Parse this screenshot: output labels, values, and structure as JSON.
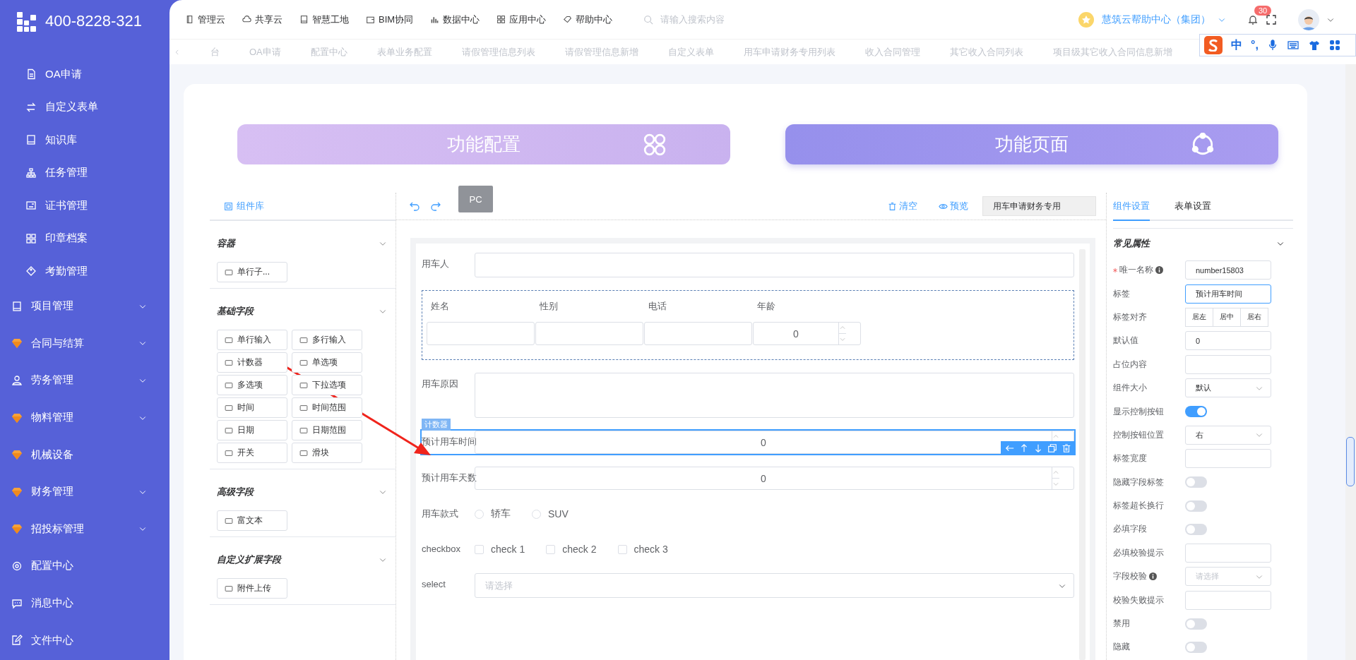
{
  "sidebar": {
    "logo_text": "400-8228-321",
    "items": [
      {
        "label": "OA申请",
        "kind": "sub",
        "expandable": false
      },
      {
        "label": "自定义表单",
        "kind": "sub",
        "expandable": false
      },
      {
        "label": "知识库",
        "kind": "sub",
        "expandable": false
      },
      {
        "label": "任务管理",
        "kind": "sub",
        "expandable": false
      },
      {
        "label": "证书管理",
        "kind": "sub",
        "expandable": false
      },
      {
        "label": "印章档案",
        "kind": "sub",
        "expandable": false
      },
      {
        "label": "考勤管理",
        "kind": "sub",
        "expandable": false
      },
      {
        "label": "项目管理",
        "kind": "group",
        "expandable": true
      },
      {
        "label": "合同与结算",
        "kind": "group",
        "expandable": true
      },
      {
        "label": "劳务管理",
        "kind": "group",
        "expandable": true
      },
      {
        "label": "物料管理",
        "kind": "group",
        "expandable": true
      },
      {
        "label": "机械设备",
        "kind": "group",
        "expandable": false
      },
      {
        "label": "财务管理",
        "kind": "group",
        "expandable": true
      },
      {
        "label": "招投标管理",
        "kind": "group",
        "expandable": true
      },
      {
        "label": "配置中心",
        "kind": "group",
        "expandable": false
      },
      {
        "label": "消息中心",
        "kind": "group",
        "expandable": false
      },
      {
        "label": "文件中心",
        "kind": "group",
        "expandable": false
      }
    ]
  },
  "topbar": {
    "nav": [
      "管理云",
      "共享云",
      "智慧工地",
      "BIM协同",
      "数据中心",
      "应用中心",
      "帮助中心"
    ],
    "search": {
      "placeholder": "请输入搜索内容"
    },
    "org": "慧筑云帮助中心（集团）",
    "notifications": "30"
  },
  "tabs": [
    "台",
    "OA申请",
    "配置中心",
    "表单业务配置",
    "请假管理信息列表",
    "请假管理信息新增",
    "自定义表单",
    "用车申请财务专用列表",
    "收入合同管理",
    "其它收入合同列表",
    "项目级其它收入合同信息新增"
  ],
  "ime_toolbar": {
    "mode": "中",
    "punct": "°,"
  },
  "mode_cards": [
    {
      "label": "功能配置",
      "selected": false
    },
    {
      "label": "功能页面",
      "selected": true
    }
  ],
  "component_library": {
    "title": "组件库",
    "groups": [
      {
        "title": "容器",
        "items": [
          "单行子..."
        ]
      },
      {
        "title": "基础字段",
        "items": [
          "单行输入",
          "多行输入",
          "计数器",
          "单选项",
          "多选项",
          "下拉选项",
          "时间",
          "时间范围",
          "日期",
          "日期范围",
          "开关",
          "滑块"
        ]
      },
      {
        "title": "高级字段",
        "items": [
          "富文本"
        ]
      },
      {
        "title": "自定义扩展字段",
        "items": [
          "附件上传"
        ]
      }
    ]
  },
  "designer": {
    "device": "PC",
    "clear": "清空",
    "preview": "预览",
    "form_name": "用车申请财务专用",
    "fields": [
      {
        "kind": "input",
        "label": "用车人",
        "selected": false
      },
      {
        "kind": "subform",
        "selected": false,
        "columns": [
          {
            "label": "姓名",
            "kind": "input"
          },
          {
            "label": "性别",
            "kind": "input"
          },
          {
            "label": "电话",
            "kind": "input"
          },
          {
            "label": "年龄",
            "kind": "number",
            "value": "0"
          }
        ]
      },
      {
        "kind": "textarea",
        "label": "用车原因",
        "selected": false
      },
      {
        "kind": "number",
        "label": "预计用车时间",
        "value": "0",
        "selected": true,
        "drag_label": "计数器"
      },
      {
        "kind": "number",
        "label": "预计用车天数",
        "value": "0",
        "selected": false
      },
      {
        "kind": "radio",
        "label": "用车款式",
        "selected": false,
        "options": [
          {
            "label": "轿车",
            "checked": false
          },
          {
            "label": "SUV",
            "checked": false
          }
        ]
      },
      {
        "kind": "checkbox",
        "label": "checkbox",
        "selected": false,
        "options": [
          {
            "label": "check 1",
            "checked": false
          },
          {
            "label": "check 2",
            "checked": false
          },
          {
            "label": "check 3",
            "checked": false
          }
        ]
      },
      {
        "kind": "select",
        "label": "select",
        "placeholder": "请选择",
        "selected": false
      }
    ]
  },
  "settings": {
    "tabs": [
      {
        "label": "组件设置",
        "selected": true
      },
      {
        "label": "表单设置",
        "selected": false
      }
    ],
    "section": "常见属性",
    "rows": [
      {
        "kind": "input",
        "label": "唯一名称",
        "required": true,
        "info": true,
        "focused": false,
        "value": "number15803"
      },
      {
        "kind": "input",
        "label": "标签",
        "required": false,
        "info": false,
        "focused": true,
        "value": "预计用车时间"
      },
      {
        "kind": "segmented",
        "label": "标签对齐",
        "required": false,
        "info": false,
        "focused": false,
        "options": [
          "居左",
          "居中",
          "居右"
        ]
      },
      {
        "kind": "input",
        "label": "默认值",
        "required": false,
        "info": false,
        "focused": false,
        "value": "0"
      },
      {
        "kind": "input",
        "label": "占位内容",
        "required": false,
        "info": false,
        "focused": false
      },
      {
        "kind": "select",
        "label": "组件大小",
        "required": false,
        "info": false,
        "focused": false,
        "value": "默认"
      },
      {
        "kind": "switch",
        "label": "显示控制按钮",
        "required": false,
        "info": false,
        "focused": false,
        "on": true
      },
      {
        "kind": "select",
        "label": "控制按钮位置",
        "required": false,
        "info": false,
        "focused": false,
        "value": "右"
      },
      {
        "kind": "input",
        "label": "标签宽度",
        "required": false,
        "info": false,
        "focused": false
      },
      {
        "kind": "switch",
        "label": "隐藏字段标签",
        "required": false,
        "info": false,
        "focused": false,
        "on": false
      },
      {
        "kind": "switch",
        "label": "标签超长换行",
        "required": false,
        "info": false,
        "focused": false,
        "on": false
      },
      {
        "kind": "switch",
        "label": "必填字段",
        "required": false,
        "info": false,
        "focused": false,
        "on": false
      },
      {
        "kind": "input",
        "label": "必填校验提示",
        "required": false,
        "info": false,
        "focused": false
      },
      {
        "kind": "select",
        "label": "字段校验",
        "required": false,
        "info": true,
        "focused": false,
        "placeholder": "请选择"
      },
      {
        "kind": "input",
        "label": "校验失败提示",
        "required": false,
        "info": false,
        "focused": false
      },
      {
        "kind": "switch",
        "label": "禁用",
        "required": false,
        "info": false,
        "focused": false,
        "on": false
      },
      {
        "kind": "switch",
        "label": "隐藏",
        "required": false,
        "info": false,
        "focused": false,
        "on": false
      }
    ]
  }
}
